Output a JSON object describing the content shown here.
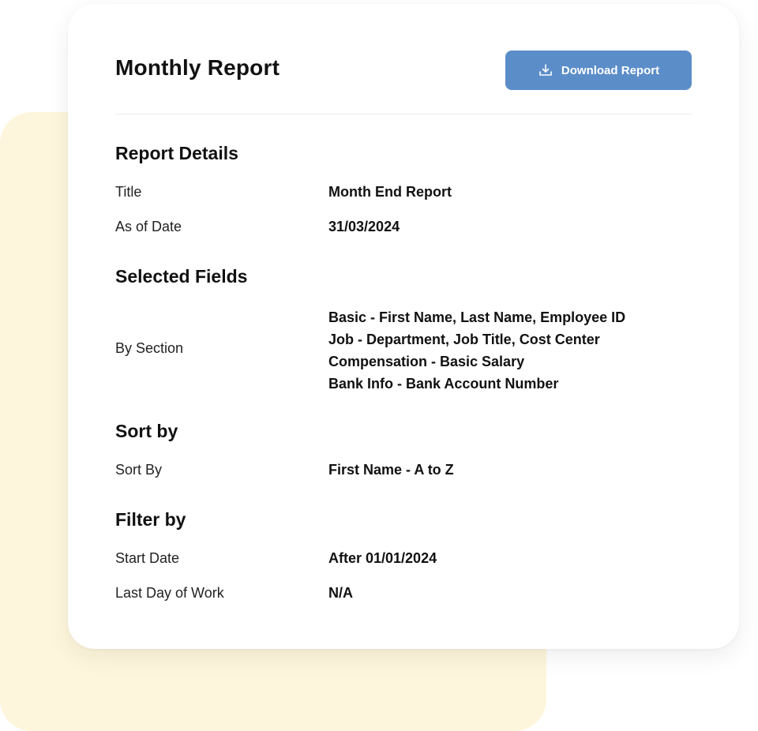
{
  "header": {
    "title": "Monthly Report",
    "download_label": "Download Report"
  },
  "report_details": {
    "heading": "Report Details",
    "rows": [
      {
        "label": "Title",
        "value": "Month End Report"
      },
      {
        "label": "As of Date",
        "value": "31/03/2024"
      }
    ]
  },
  "selected_fields": {
    "heading": "Selected Fields",
    "label": "By Section",
    "values": [
      "Basic - First Name, Last Name, Employee ID",
      "Job - Department, Job Title, Cost Center",
      "Compensation - Basic Salary",
      "Bank Info - Bank Account Number"
    ]
  },
  "sort_by": {
    "heading": "Sort by",
    "rows": [
      {
        "label": "Sort By",
        "value": "First Name - A to Z"
      }
    ]
  },
  "filter_by": {
    "heading": "Filter by",
    "rows": [
      {
        "label": "Start Date",
        "value": "After 01/01/2024"
      },
      {
        "label": "Last Day of Work",
        "value": "N/A"
      }
    ]
  },
  "icons": {
    "download": "download-icon"
  },
  "colors": {
    "accent": "#5b8dc9",
    "background_panel": "#fef6dc",
    "card": "#ffffff"
  }
}
